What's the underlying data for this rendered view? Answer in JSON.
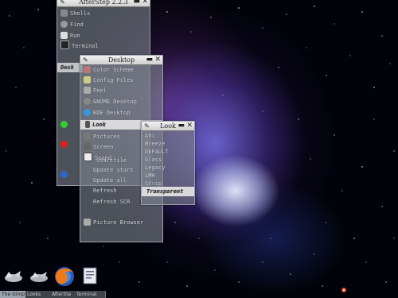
{
  "afterstep_window": {
    "title": "AfterStep 2.2.3",
    "items": [
      "Shells",
      "Find",
      "Run",
      "Terminal"
    ],
    "side_items": [
      "Desk",
      "Desk",
      "Scr",
      "Quit"
    ]
  },
  "desktop_window": {
    "title": "Desktop",
    "items": [
      "Color Scheme",
      "Config Files",
      "Feel",
      "GNOME Desktop",
      "KDE Desktop",
      "Look",
      "Pictures",
      "Screen",
      "Sound",
      "Startfile",
      "Update start",
      "Update all",
      "Refresh",
      "Refresh SCR",
      "Picture Browser"
    ]
  },
  "look_window": {
    "title": "Look",
    "items": [
      "Ahi",
      "Breeze",
      "DEFAULT",
      "Glass",
      "Legacy",
      "LMH",
      "Strip",
      "Transparent"
    ],
    "selected": "Transparent"
  },
  "dock": {
    "icons": [
      "gnome-foot-icon",
      "gnome-foot-icon-2",
      "firefox-icon",
      "document-icon"
    ]
  },
  "taskbar": {
    "buttons": [
      "The Gimp",
      "Looks",
      "AfterSte",
      "Terminal"
    ]
  }
}
